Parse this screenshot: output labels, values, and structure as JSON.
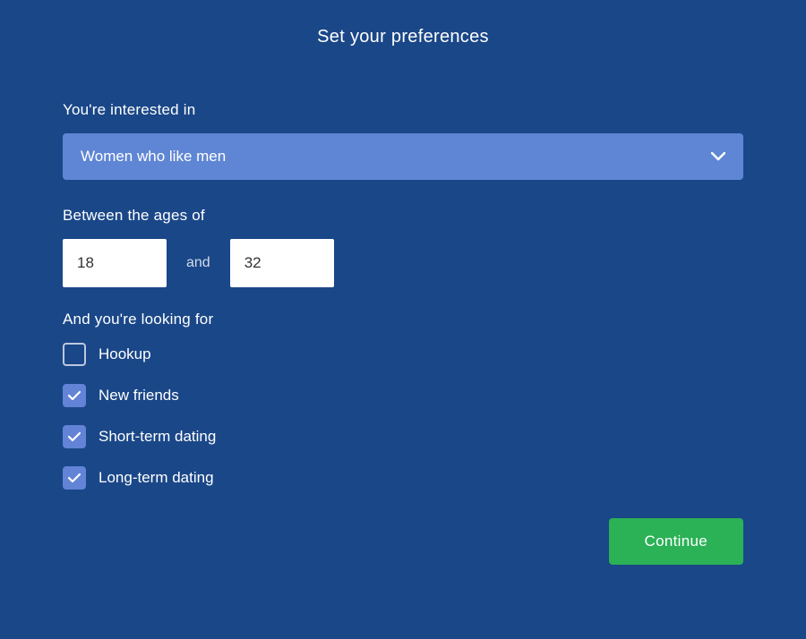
{
  "title": "Set your preferences",
  "interested": {
    "label": "You're interested in",
    "selected": "Women who like men"
  },
  "ages": {
    "label": "Between the ages of",
    "min": "18",
    "and": "and",
    "max": "32"
  },
  "looking": {
    "label": "And you're looking for",
    "options": [
      {
        "label": "Hookup",
        "checked": false
      },
      {
        "label": "New friends",
        "checked": true
      },
      {
        "label": "Short-term dating",
        "checked": true
      },
      {
        "label": "Long-term dating",
        "checked": true
      }
    ]
  },
  "continue_label": "Continue",
  "colors": {
    "background": "#1a4788",
    "dropdown": "#5f86d4",
    "checkbox_checked": "#6283d6",
    "continue": "#2bb156"
  }
}
